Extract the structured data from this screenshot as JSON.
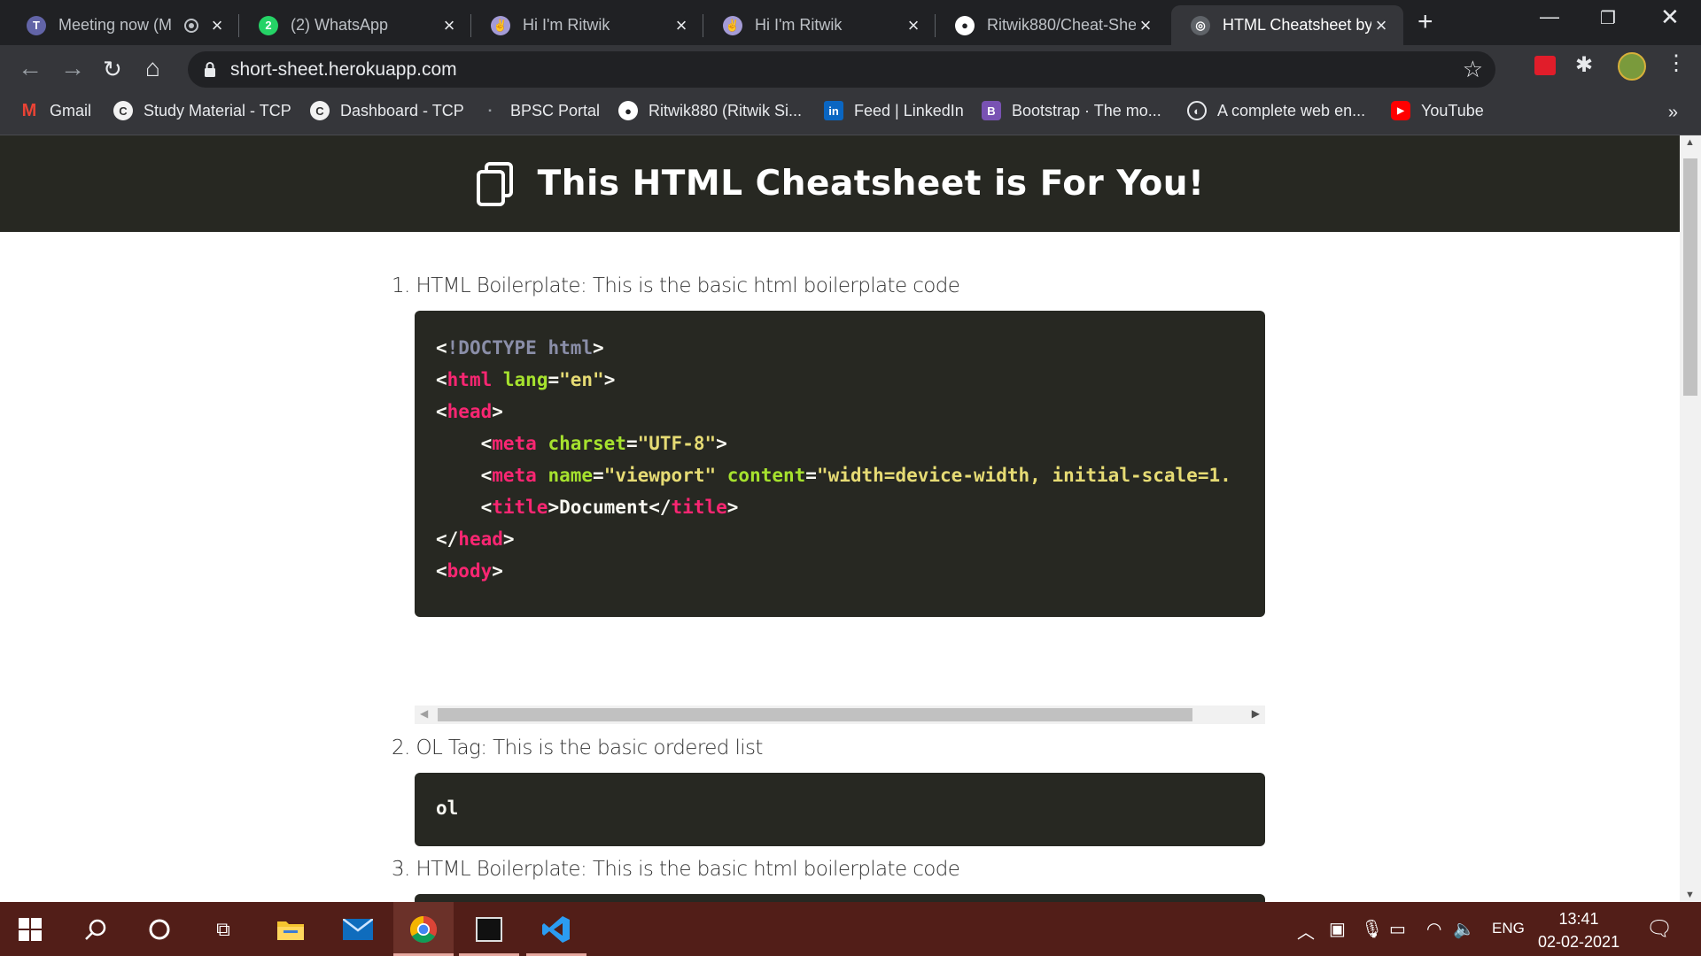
{
  "browser": {
    "tabs": [
      {
        "title": "Meeting now (M",
        "icon": "teams-icon",
        "color": "#6264a7"
      },
      {
        "title": "(2) WhatsApp",
        "icon": "whatsapp-icon",
        "color": "#25d366",
        "badge": "2"
      },
      {
        "title": "Hi I'm Ritwik",
        "icon": "peace-hand-icon",
        "color": "#a49bd6"
      },
      {
        "title": "Hi I'm Ritwik",
        "icon": "peace-hand-icon",
        "color": "#a49bd6"
      },
      {
        "title": "Ritwik880/Cheat-She",
        "icon": "github-icon",
        "color": "#ffffff"
      },
      {
        "title": "HTML Cheatsheet by",
        "icon": "globe-icon",
        "color": "#9aa0a6"
      }
    ],
    "address": "short-sheet.herokuapp.com",
    "bookmarks": [
      {
        "label": "Gmail",
        "icon": "gmail-icon",
        "color": "#ea4335"
      },
      {
        "label": "Study Material - TCP",
        "icon": "tcp-icon",
        "color": "#f2f2f2"
      },
      {
        "label": "Dashboard - TCP",
        "icon": "tcp-icon",
        "color": "#f2f2f2"
      },
      {
        "label": "BPSC Portal",
        "icon": "bpsc-icon",
        "color": "#9aa0a6"
      },
      {
        "label": "Ritwik880 (Ritwik Si...",
        "icon": "github-icon",
        "color": "#ffffff"
      },
      {
        "label": "Feed | LinkedIn",
        "icon": "linkedin-icon",
        "color": "#0a66c2"
      },
      {
        "label": "Bootstrap · The mo...",
        "icon": "bootstrap-icon",
        "color": "#7952b3"
      },
      {
        "label": "A complete web en...",
        "icon": "globe-icon",
        "color": "#e8eaed"
      },
      {
        "label": "YouTube",
        "icon": "youtube-icon",
        "color": "#ff0000"
      }
    ]
  },
  "page": {
    "title": "This HTML Cheatsheet is For You!",
    "items": [
      {
        "number": "1.",
        "text": "HTML Boilerplate: This is the basic html boilerplate code"
      },
      {
        "number": "2.",
        "text": "OL Tag: This is the basic ordered list",
        "code": "ol"
      },
      {
        "number": "3.",
        "text": "HTML Boilerplate: This is the basic html boilerplate code"
      }
    ]
  },
  "taskbar": {
    "language": "ENG",
    "time": "13:41",
    "date": "02-02-2021"
  },
  "colors": {
    "header_bg": "#272822",
    "code_tag": "#f92672",
    "code_attr": "#a6e22e",
    "code_string": "#e6db74",
    "taskbar_bg": "#521e18"
  }
}
